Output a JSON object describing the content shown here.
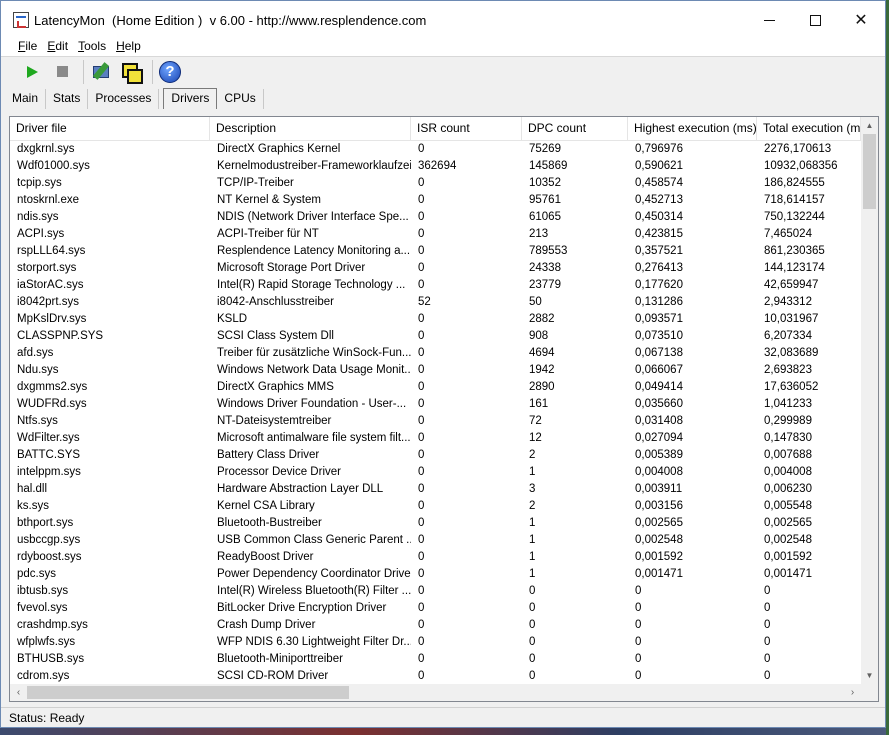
{
  "window": {
    "title": "LatencyMon  (Home Edition )  v 6.00 - http://www.resplendence.com"
  },
  "menu": [
    {
      "label": "File",
      "key": "F",
      "rest": "ile"
    },
    {
      "label": "Edit",
      "key": "E",
      "rest": "dit"
    },
    {
      "label": "Tools",
      "key": "T",
      "rest": "ools"
    },
    {
      "label": "Help",
      "key": "H",
      "rest": "elp"
    }
  ],
  "toolbar": {
    "icons": [
      "play-icon",
      "stop-icon",
      "wrench-icon",
      "windows-icon",
      "help-icon"
    ],
    "help_glyph": "?"
  },
  "tabs": [
    {
      "label": "Main",
      "active": false
    },
    {
      "label": "Stats",
      "active": false
    },
    {
      "label": "Processes",
      "active": false
    },
    {
      "label": "Drivers",
      "active": true
    },
    {
      "label": "CPUs",
      "active": false
    }
  ],
  "table": {
    "columns": [
      "Driver file",
      "Description",
      "ISR count",
      "DPC count",
      "Highest execution (ms)",
      "Total execution (ms)"
    ],
    "rows": [
      [
        "dxgkrnl.sys",
        "DirectX Graphics Kernel",
        "0",
        "75269",
        "0,796976",
        "2276,170613"
      ],
      [
        "Wdf01000.sys",
        "Kernelmodustreiber-Frameworklaufzeit",
        "362694",
        "145869",
        "0,590621",
        "10932,068356"
      ],
      [
        "tcpip.sys",
        "TCP/IP-Treiber",
        "0",
        "10352",
        "0,458574",
        "186,824555"
      ],
      [
        "ntoskrnl.exe",
        "NT Kernel & System",
        "0",
        "95761",
        "0,452713",
        "718,614157"
      ],
      [
        "ndis.sys",
        "NDIS (Network Driver Interface Spe...",
        "0",
        "61065",
        "0,450314",
        "750,132244"
      ],
      [
        "ACPI.sys",
        "ACPI-Treiber für NT",
        "0",
        "213",
        "0,423815",
        "7,465024"
      ],
      [
        "rspLLL64.sys",
        "Resplendence Latency Monitoring a...",
        "0",
        "789553",
        "0,357521",
        "861,230365"
      ],
      [
        "storport.sys",
        "Microsoft Storage Port Driver",
        "0",
        "24338",
        "0,276413",
        "144,123174"
      ],
      [
        "iaStorAC.sys",
        "Intel(R) Rapid Storage Technology ...",
        "0",
        "23779",
        "0,177620",
        "42,659947"
      ],
      [
        "i8042prt.sys",
        "i8042-Anschlusstreiber",
        "52",
        "50",
        "0,131286",
        "2,943312"
      ],
      [
        "MpKslDrv.sys",
        "KSLD",
        "0",
        "2882",
        "0,093571",
        "10,031967"
      ],
      [
        "CLASSPNP.SYS",
        "SCSI Class System Dll",
        "0",
        "908",
        "0,073510",
        "6,207334"
      ],
      [
        "afd.sys",
        "Treiber für zusätzliche WinSock-Fun...",
        "0",
        "4694",
        "0,067138",
        "32,083689"
      ],
      [
        "Ndu.sys",
        "Windows Network Data Usage Monit...",
        "0",
        "1942",
        "0,066067",
        "2,693823"
      ],
      [
        "dxgmms2.sys",
        "DirectX Graphics MMS",
        "0",
        "2890",
        "0,049414",
        "17,636052"
      ],
      [
        "WUDFRd.sys",
        "Windows Driver Foundation - User-...",
        "0",
        "161",
        "0,035660",
        "1,041233"
      ],
      [
        "Ntfs.sys",
        "NT-Dateisystemtreiber",
        "0",
        "72",
        "0,031408",
        "0,299989"
      ],
      [
        "WdFilter.sys",
        "Microsoft antimalware file system filt...",
        "0",
        "12",
        "0,027094",
        "0,147830"
      ],
      [
        "BATTC.SYS",
        "Battery Class Driver",
        "0",
        "2",
        "0,005389",
        "0,007688"
      ],
      [
        "intelppm.sys",
        "Processor Device Driver",
        "0",
        "1",
        "0,004008",
        "0,004008"
      ],
      [
        "hal.dll",
        "Hardware Abstraction Layer DLL",
        "0",
        "3",
        "0,003911",
        "0,006230"
      ],
      [
        "ks.sys",
        "Kernel CSA Library",
        "0",
        "2",
        "0,003156",
        "0,005548"
      ],
      [
        "bthport.sys",
        "Bluetooth-Bustreiber",
        "0",
        "1",
        "0,002565",
        "0,002565"
      ],
      [
        "usbccgp.sys",
        "USB Common Class Generic Parent ...",
        "0",
        "1",
        "0,002548",
        "0,002548"
      ],
      [
        "rdyboost.sys",
        "ReadyBoost Driver",
        "0",
        "1",
        "0,001592",
        "0,001592"
      ],
      [
        "pdc.sys",
        "Power Dependency Coordinator Driver",
        "0",
        "1",
        "0,001471",
        "0,001471"
      ],
      [
        "ibtusb.sys",
        "Intel(R) Wireless Bluetooth(R) Filter ...",
        "0",
        "0",
        "0",
        "0"
      ],
      [
        "fvevol.sys",
        "BitLocker Drive Encryption Driver",
        "0",
        "0",
        "0",
        "0"
      ],
      [
        "crashdmp.sys",
        "Crash Dump Driver",
        "0",
        "0",
        "0",
        "0"
      ],
      [
        "wfplwfs.sys",
        "WFP NDIS 6.30 Lightweight Filter Dr...",
        "0",
        "0",
        "0",
        "0"
      ],
      [
        "BTHUSB.sys",
        "Bluetooth-Miniporttreiber",
        "0",
        "0",
        "0",
        "0"
      ],
      [
        "cdrom.sys",
        "SCSI CD-ROM Driver",
        "0",
        "0",
        "0",
        "0"
      ]
    ]
  },
  "status": {
    "text": "Status: Ready"
  },
  "colors": {
    "play": "#1fa81f",
    "stop": "#8a8a8a",
    "help": "#1742b0"
  }
}
